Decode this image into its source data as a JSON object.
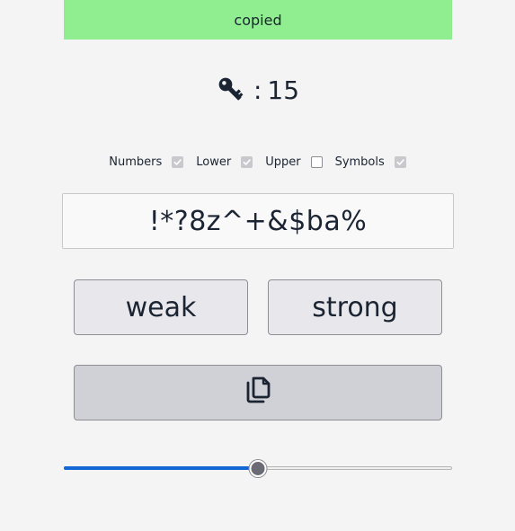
{
  "banner": {
    "text": "copied",
    "color": "#90ee90"
  },
  "length": {
    "icon": "key-icon",
    "separator": ":",
    "value": "15"
  },
  "options": [
    {
      "label": "Numbers",
      "checked": true
    },
    {
      "label": "Lower",
      "checked": true
    },
    {
      "label": "Upper",
      "checked": false
    },
    {
      "label": "Symbols",
      "checked": true
    }
  ],
  "password": {
    "value": "!*?8z^+&$ba%"
  },
  "buttons": {
    "weak_label": "weak",
    "strong_label": "strong",
    "copy_icon": "copy-icon"
  },
  "slider": {
    "fraction": 0.5,
    "accent": "#1667d6"
  }
}
